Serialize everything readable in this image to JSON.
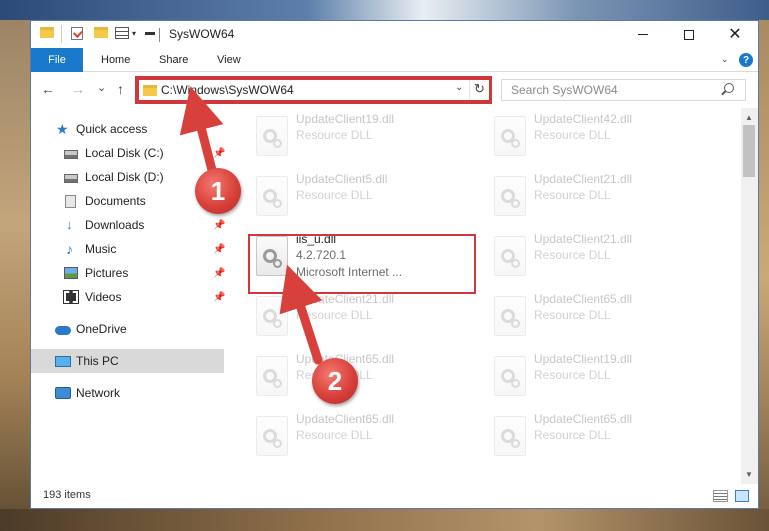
{
  "window": {
    "title": "SysWOW64",
    "controls": {
      "minimize": "minimize",
      "maximize": "maximize",
      "close": "✕"
    }
  },
  "ribbon": {
    "tabs": [
      "File",
      "Home",
      "Share",
      "View"
    ],
    "help": "?"
  },
  "nav": {
    "back": "←",
    "forward": "→",
    "recent": "⌄",
    "up": "↑",
    "address": "C:\\Windows\\SysWOW64",
    "refresh": "↻",
    "search_placeholder": "Search SysWOW64"
  },
  "sidebar": {
    "items": [
      {
        "label": "Quick access",
        "icon": "star-icon",
        "pinned": false
      },
      {
        "label": "Local Disk (C:)",
        "icon": "disk-icon",
        "pinned": true
      },
      {
        "label": "Local Disk (D:)",
        "icon": "disk-icon",
        "pinned": false
      },
      {
        "label": "Documents",
        "icon": "documents-icon",
        "pinned": true
      },
      {
        "label": "Downloads",
        "icon": "download-icon",
        "pinned": true
      },
      {
        "label": "Music",
        "icon": "music-icon",
        "pinned": true
      },
      {
        "label": "Pictures",
        "icon": "pictures-icon",
        "pinned": true
      },
      {
        "label": "Videos",
        "icon": "videos-icon",
        "pinned": true
      },
      {
        "label": "OneDrive",
        "icon": "cloud-icon",
        "pinned": false
      },
      {
        "label": "This PC",
        "icon": "pc-icon",
        "pinned": false,
        "selected": true
      },
      {
        "label": "Network",
        "icon": "network-icon",
        "pinned": false
      }
    ]
  },
  "files": {
    "left": [
      {
        "name": "UpdateClient19.dll",
        "desc": "Resource DLL"
      },
      {
        "name": "UpdateClient5.dll",
        "desc": "Resource DLL"
      },
      {
        "name": "iis_u.dll",
        "version": "4.2.720.1",
        "desc": "Microsoft Internet ...",
        "highlighted": true
      },
      {
        "name": "UpdateClient21.dll",
        "desc": "Resource DLL"
      },
      {
        "name": "UpdateClient65.dll",
        "desc": "Resource DLL"
      },
      {
        "name": "UpdateClient65.dll",
        "desc": "Resource DLL"
      }
    ],
    "right": [
      {
        "name": "UpdateClient42.dll",
        "desc": "Resource DLL"
      },
      {
        "name": "UpdateClient21.dll",
        "desc": "Resource DLL"
      },
      {
        "name": "UpdateClient21.dll",
        "desc": "Resource DLL"
      },
      {
        "name": "UpdateClient65.dll",
        "desc": "Resource DLL"
      },
      {
        "name": "UpdateClient19.dll",
        "desc": "Resource DLL"
      },
      {
        "name": "UpdateClient65.dll",
        "desc": "Resource DLL"
      }
    ]
  },
  "status": {
    "item_count": "193 items"
  },
  "callouts": [
    "1",
    "2"
  ],
  "colors": {
    "accent": "#1979ca",
    "highlight": "#d0373b",
    "selected": "#d9d9d9"
  }
}
